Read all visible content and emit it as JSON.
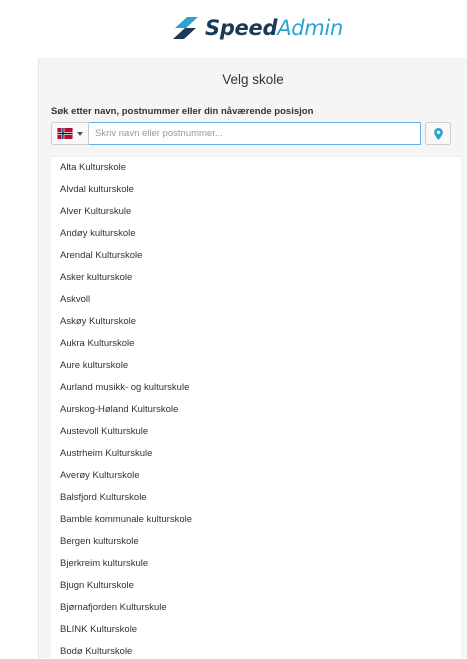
{
  "brand": {
    "name_part1": "Speed",
    "name_part2": "Admin",
    "colors": {
      "dark": "#1b3a57",
      "accent": "#2aa3d4"
    }
  },
  "panel": {
    "title": "Velg skole",
    "search_label": "Søk etter navn, postnummer eller din nåværende posisjon",
    "search_placeholder": "Skriv navn eller postnummer...",
    "flag_icon": "norway-flag-icon",
    "location_icon": "map-marker-icon"
  },
  "schools": [
    "Alta Kulturskole",
    "Alvdal kulturskole",
    "Alver Kulturskule",
    "Andøy kulturskole",
    "Arendal Kulturskole",
    "Asker kulturskole",
    "Askvoll",
    "Askøy Kulturskole",
    "Aukra Kulturskole",
    "Aure kulturskole",
    "Aurland musikk- og kulturskule",
    "Aurskog-Høland Kulturskole",
    "Austevoll Kulturskule",
    "Austrheim Kulturskule",
    "Averøy Kulturskole",
    "Balsfjord Kulturskole",
    "Bamble kommunale kulturskole",
    "Bergen kulturskole",
    "Bjerkreim kulturskule",
    "Bjugn Kulturskole",
    "Bjørnafjorden Kulturskule",
    "BLINK Kulturskole",
    "Bodø Kulturskole"
  ]
}
